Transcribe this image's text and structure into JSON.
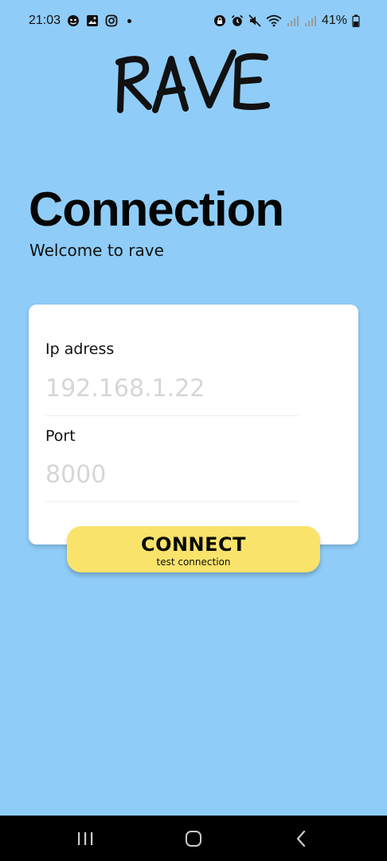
{
  "status_bar": {
    "time": "21:03",
    "battery": "41%",
    "left_icons": [
      "face-icon",
      "image-icon",
      "instagram-icon"
    ],
    "right_icons": [
      "lock-icon",
      "alarm-icon",
      "mute-icon",
      "wifi-icon",
      "signal-icon",
      "signal-icon",
      "battery-icon"
    ]
  },
  "app": {
    "logo_text": "RAVE",
    "title": "Connection",
    "subtitle": "Welcome to rave"
  },
  "form": {
    "ip_label": "Ip adress",
    "ip_placeholder": "192.168.1.22",
    "port_label": "Port",
    "port_placeholder": "8000"
  },
  "connect_button": {
    "label": "CONNECT",
    "sublabel": "test connection"
  },
  "navigation": {
    "buttons": [
      "recents-icon",
      "home-icon",
      "back-icon"
    ]
  },
  "colors": {
    "background": "#8fcdf8",
    "card": "#ffffff",
    "button": "#fae36a",
    "navbar": "#000000"
  }
}
